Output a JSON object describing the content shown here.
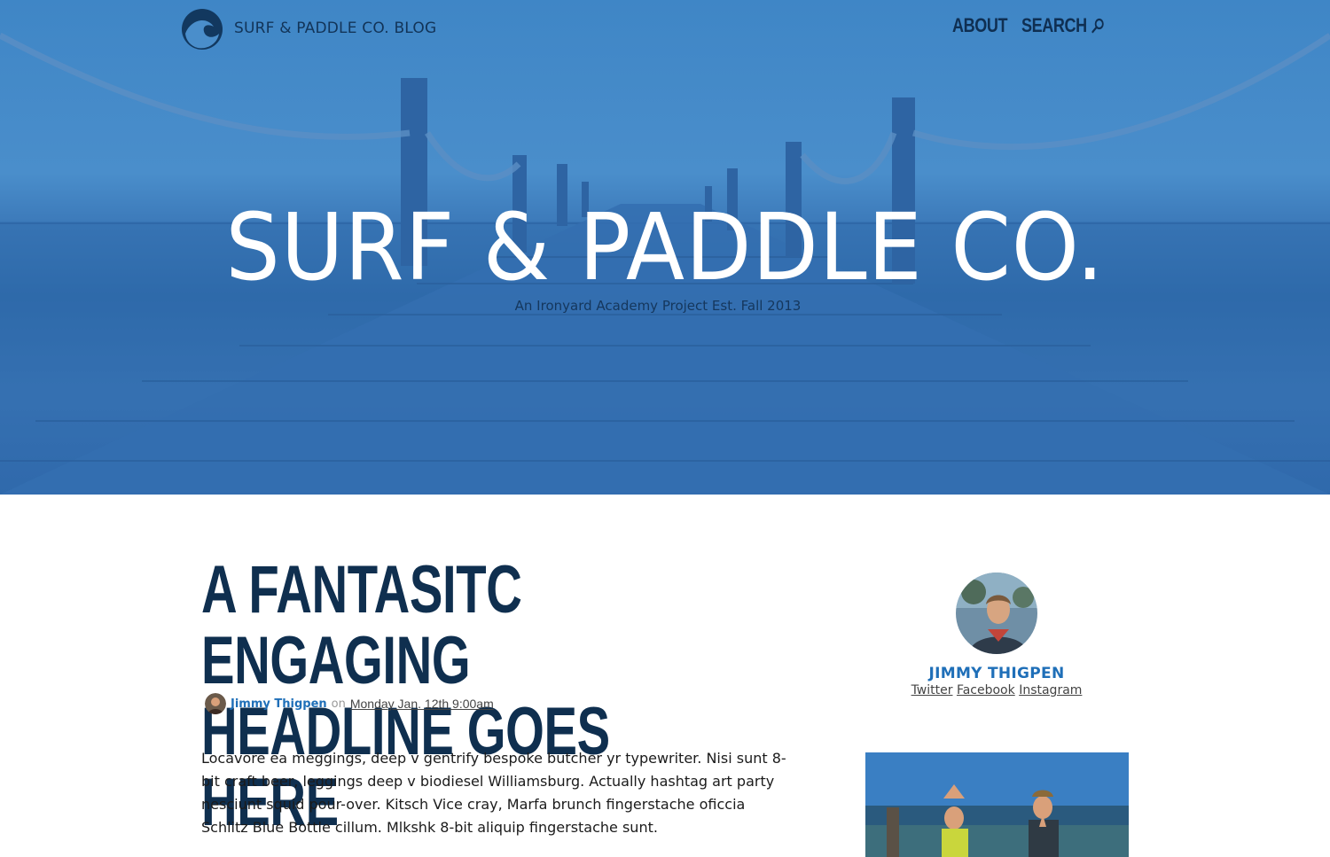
{
  "header": {
    "blog_name": "SURF & PADDLE CO. BLOG",
    "nav": {
      "about": "ABOUT",
      "search": "SEARCH"
    }
  },
  "hero": {
    "title": "SURF & PADDLE CO.",
    "subtitle": "An Ironyard Academy Project Est. Fall 2013"
  },
  "post": {
    "title_line1": "A FANTASITC ENGAGING",
    "title_line2": "HEADLINE GOES HERE",
    "author": "Jimmy Thigpen",
    "on": "on",
    "date": "Monday Jan. 12th 9:00am",
    "body": "Locavore ea meggings, deep v gentrify bespoke butcher yr typewriter. Nisi sunt 8-bit craft beer, leggings deep v biodiesel Williamsburg. Actually hashtag art party nesciunt squid pour-over. Kitsch Vice cray, Marfa brunch fingerstache oficcia Schlitz Blue Bottle cillum. Mlkshk 8-bit aliquip fingerstache sunt."
  },
  "author_card": {
    "name": "JIMMY THIGPEN",
    "links": [
      "Twitter",
      "Facebook",
      "Instagram"
    ]
  },
  "colors": {
    "hero_blue": "#3f86c6",
    "navy": "#0f2f4f",
    "link_blue": "#1f6fb8"
  },
  "icons": {
    "logo": "wave-logo-icon",
    "search": "search-icon"
  }
}
